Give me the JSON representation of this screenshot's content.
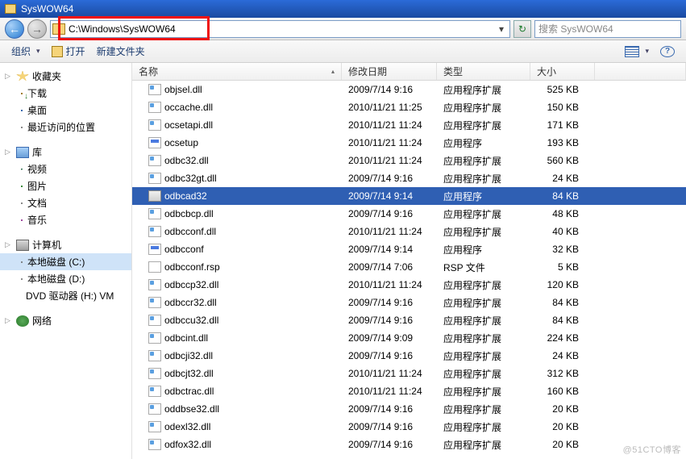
{
  "window": {
    "title": "SysWOW64"
  },
  "address": {
    "path": "C:\\Windows\\SysWOW64"
  },
  "search": {
    "placeholder": "搜索 SysWOW64"
  },
  "toolbar": {
    "organize": "组织",
    "open": "打开",
    "newfolder": "新建文件夹"
  },
  "sidebar": {
    "favorites": {
      "label": "收藏夹",
      "items": [
        {
          "label": "下载",
          "icon": "ico-dl"
        },
        {
          "label": "桌面",
          "icon": "ico-desktop"
        },
        {
          "label": "最近访问的位置",
          "icon": "ico-recent"
        }
      ]
    },
    "libraries": {
      "label": "库",
      "items": [
        {
          "label": "视频",
          "icon": "ico-video"
        },
        {
          "label": "图片",
          "icon": "ico-pic"
        },
        {
          "label": "文档",
          "icon": "ico-doc"
        },
        {
          "label": "音乐",
          "icon": "ico-music"
        }
      ]
    },
    "computer": {
      "label": "计算机",
      "items": [
        {
          "label": "本地磁盘 (C:)",
          "icon": "ico-drive",
          "selected": true
        },
        {
          "label": "本地磁盘 (D:)",
          "icon": "ico-drive"
        },
        {
          "label": "DVD 驱动器 (H:) VM",
          "icon": "ico-dvd"
        }
      ]
    },
    "network": {
      "label": "网络"
    }
  },
  "columns": {
    "name": "名称",
    "date": "修改日期",
    "type": "类型",
    "size": "大小"
  },
  "files": [
    {
      "name": "objsel.dll",
      "date": "2009/7/14 9:16",
      "type": "应用程序扩展",
      "size": "525 KB",
      "icon": "fi-dll"
    },
    {
      "name": "occache.dll",
      "date": "2010/11/21 11:25",
      "type": "应用程序扩展",
      "size": "150 KB",
      "icon": "fi-dll"
    },
    {
      "name": "ocsetapi.dll",
      "date": "2010/11/21 11:24",
      "type": "应用程序扩展",
      "size": "171 KB",
      "icon": "fi-dll"
    },
    {
      "name": "ocsetup",
      "date": "2010/11/21 11:24",
      "type": "应用程序",
      "size": "193 KB",
      "icon": "fi-exe"
    },
    {
      "name": "odbc32.dll",
      "date": "2010/11/21 11:24",
      "type": "应用程序扩展",
      "size": "560 KB",
      "icon": "fi-dll"
    },
    {
      "name": "odbc32gt.dll",
      "date": "2009/7/14 9:16",
      "type": "应用程序扩展",
      "size": "24 KB",
      "icon": "fi-dll"
    },
    {
      "name": "odbcad32",
      "date": "2009/7/14 9:14",
      "type": "应用程序",
      "size": "84 KB",
      "icon": "fi-exe2",
      "selected": true
    },
    {
      "name": "odbcbcp.dll",
      "date": "2009/7/14 9:16",
      "type": "应用程序扩展",
      "size": "48 KB",
      "icon": "fi-dll"
    },
    {
      "name": "odbcconf.dll",
      "date": "2010/11/21 11:24",
      "type": "应用程序扩展",
      "size": "40 KB",
      "icon": "fi-dll"
    },
    {
      "name": "odbcconf",
      "date": "2009/7/14 9:14",
      "type": "应用程序",
      "size": "32 KB",
      "icon": "fi-exe"
    },
    {
      "name": "odbcconf.rsp",
      "date": "2009/7/14 7:06",
      "type": "RSP 文件",
      "size": "5 KB",
      "icon": "fi-rsp"
    },
    {
      "name": "odbccp32.dll",
      "date": "2010/11/21 11:24",
      "type": "应用程序扩展",
      "size": "120 KB",
      "icon": "fi-dll"
    },
    {
      "name": "odbccr32.dll",
      "date": "2009/7/14 9:16",
      "type": "应用程序扩展",
      "size": "84 KB",
      "icon": "fi-dll"
    },
    {
      "name": "odbccu32.dll",
      "date": "2009/7/14 9:16",
      "type": "应用程序扩展",
      "size": "84 KB",
      "icon": "fi-dll"
    },
    {
      "name": "odbcint.dll",
      "date": "2009/7/14 9:09",
      "type": "应用程序扩展",
      "size": "224 KB",
      "icon": "fi-dll"
    },
    {
      "name": "odbcji32.dll",
      "date": "2009/7/14 9:16",
      "type": "应用程序扩展",
      "size": "24 KB",
      "icon": "fi-dll"
    },
    {
      "name": "odbcjt32.dll",
      "date": "2010/11/21 11:24",
      "type": "应用程序扩展",
      "size": "312 KB",
      "icon": "fi-dll"
    },
    {
      "name": "odbctrac.dll",
      "date": "2010/11/21 11:24",
      "type": "应用程序扩展",
      "size": "160 KB",
      "icon": "fi-dll"
    },
    {
      "name": "oddbse32.dll",
      "date": "2009/7/14 9:16",
      "type": "应用程序扩展",
      "size": "20 KB",
      "icon": "fi-dll"
    },
    {
      "name": "odexl32.dll",
      "date": "2009/7/14 9:16",
      "type": "应用程序扩展",
      "size": "20 KB",
      "icon": "fi-dll"
    },
    {
      "name": "odfox32.dll",
      "date": "2009/7/14 9:16",
      "type": "应用程序扩展",
      "size": "20 KB",
      "icon": "fi-dll"
    }
  ],
  "watermark": "@51CTO博客"
}
